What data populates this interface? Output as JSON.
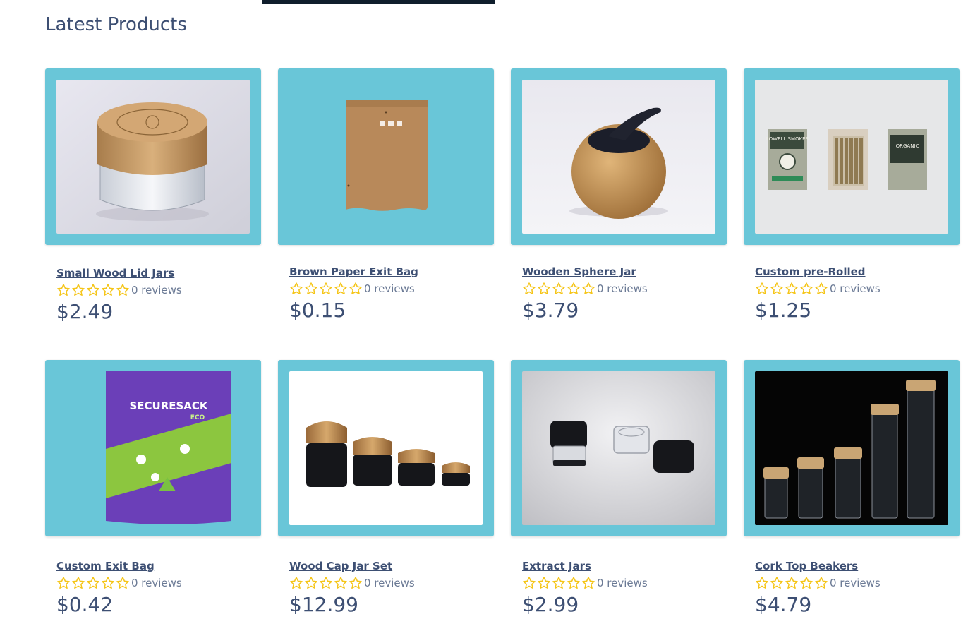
{
  "section_title": "Latest Products",
  "colors": {
    "card_background": "#69c6d8",
    "text": "#3d4f73",
    "star": "#f5c518",
    "top_bar": "#0f1e2c"
  },
  "products": [
    {
      "name": "Small Wood Lid Jars",
      "reviews": "0 reviews",
      "price": "$2.49",
      "rating": 0,
      "image_icon": "wood-lid-glass-jar"
    },
    {
      "name": "Brown Paper Exit Bag",
      "reviews": "0 reviews",
      "price": "$0.15",
      "rating": 0,
      "image_icon": "kraft-paper-pouch"
    },
    {
      "name": "Wooden Sphere Jar",
      "reviews": "0 reviews",
      "price": "$3.79",
      "rating": 0,
      "image_icon": "wooden-sphere-jar"
    },
    {
      "name": "Custom pre-Rolled",
      "reviews": "0 reviews",
      "price": "$1.25",
      "rating": 0,
      "image_icon": "pre-roll-boxes"
    },
    {
      "name": "Custom Exit Bag",
      "reviews": "0 reviews",
      "price": "$0.42",
      "rating": 0,
      "image_icon": "purple-exit-bag"
    },
    {
      "name": "Wood Cap Jar Set",
      "reviews": "0 reviews",
      "price": "$12.99",
      "rating": 0,
      "image_icon": "wood-cap-jar-set"
    },
    {
      "name": "Extract Jars",
      "reviews": "0 reviews",
      "price": "$2.99",
      "rating": 0,
      "image_icon": "extract-jars"
    },
    {
      "name": "Cork Top Beakers",
      "reviews": "0 reviews",
      "price": "$4.79",
      "rating": 0,
      "image_icon": "cork-top-beakers"
    }
  ],
  "bag_label": {
    "brand": "SECURESACK",
    "sub": "ECO"
  },
  "box_label": {
    "brand": "LOWELL SMOKES",
    "side": "ORGANIC"
  }
}
